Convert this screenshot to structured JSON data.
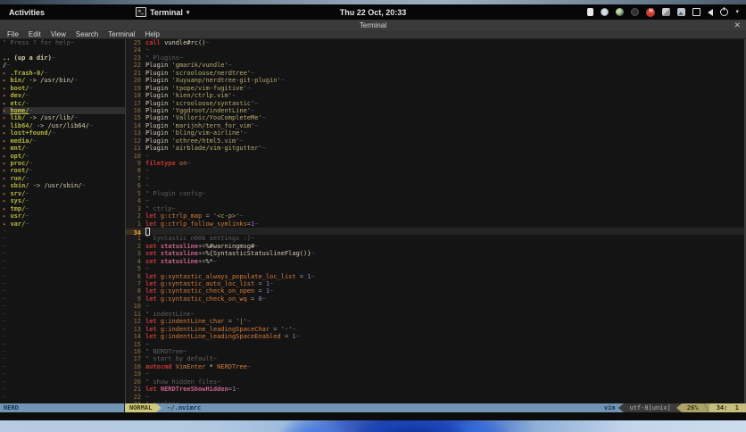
{
  "top_bar": {
    "activities": "Activities",
    "app_name": "Terminal",
    "app_caret": "▾",
    "clock": "Thu 22 Oct, 20:33",
    "terminal_icon_glyph": ">_",
    "tray": [
      {
        "name": "input-source-icon",
        "kind": "ti-input"
      },
      {
        "name": "timer-icon",
        "kind": "ti-timer"
      },
      {
        "name": "app-indicator-icon",
        "kind": "ti-cham"
      },
      {
        "name": "paw-app-icon",
        "kind": "ti-paw"
      },
      {
        "name": "recorder-h-icon",
        "kind": "ti-rec",
        "badge": "H"
      },
      {
        "name": "photos-icon",
        "kind": "ti-photos"
      },
      {
        "name": "screenshot-image-icon",
        "kind": "ti-image"
      },
      {
        "name": "display-icon",
        "kind": "ti-display"
      },
      {
        "name": "volume-icon",
        "kind": "ti-volume"
      },
      {
        "name": "power-icon",
        "kind": "ti-power"
      },
      {
        "name": "tray-caret-icon",
        "kind": "ti-caret",
        "badge": "▾"
      }
    ]
  },
  "window": {
    "title": "Terminal",
    "close": "✕",
    "menus": [
      "File",
      "Edit",
      "View",
      "Search",
      "Terminal",
      "Help"
    ]
  },
  "colors": {
    "blue": "#7295b5",
    "khaki": "#cec97e",
    "kw": "#c03732",
    "id": "#d27b38",
    "pk": "#c7608a",
    "str": "#b9aa6d",
    "num": "#9a79c6",
    "cmt": "#5f5f5f",
    "dir": "#b3b33f",
    "linenr": "#8a6d3b",
    "linenrcur": "#e8a33d",
    "eol": "#44566a"
  },
  "vim": {
    "nerdtree": [
      {
        "s": [
          [
            "cmt",
            "\" Press ? for help"
          ],
          [
            "eol",
            "~"
          ]
        ]
      },
      {
        "s": []
      },
      {
        "s": [
          [
            "upd",
            ".. (up a dir)"
          ],
          [
            "eol",
            "~"
          ]
        ]
      },
      {
        "s": [
          [
            "root",
            "/"
          ],
          [
            "eol",
            "~"
          ]
        ]
      },
      {
        "s": [
          [
            "bul",
            "▸ "
          ],
          [
            "dir",
            ".Trash-0/"
          ],
          [
            "eol",
            "~"
          ]
        ]
      },
      {
        "s": [
          [
            "bul",
            "▸ "
          ],
          [
            "dir",
            "bin/"
          ],
          [
            "lnk",
            " -> /usr/bin/"
          ],
          [
            "eol",
            "~"
          ]
        ]
      },
      {
        "s": [
          [
            "bul",
            "▸ "
          ],
          [
            "dir",
            "boot/"
          ],
          [
            "eol",
            "~"
          ]
        ]
      },
      {
        "s": [
          [
            "bul",
            "▸ "
          ],
          [
            "dir",
            "dev/"
          ],
          [
            "eol",
            "~"
          ]
        ]
      },
      {
        "s": [
          [
            "bul",
            "▸ "
          ],
          [
            "dir",
            "etc/"
          ],
          [
            "eol",
            "~"
          ]
        ]
      },
      {
        "hl": true,
        "s": [
          [
            "bul",
            "▸ "
          ],
          [
            "dirhl",
            "home/"
          ],
          [
            "eol",
            "~"
          ]
        ]
      },
      {
        "s": [
          [
            "bul",
            "▸ "
          ],
          [
            "dir",
            "lib/"
          ],
          [
            "lnk",
            " -> /usr/lib/"
          ],
          [
            "eol",
            "~"
          ]
        ]
      },
      {
        "s": [
          [
            "bul",
            "▸ "
          ],
          [
            "dir",
            "lib64/"
          ],
          [
            "lnk",
            " -> /usr/lib64/"
          ],
          [
            "eol",
            "~"
          ]
        ]
      },
      {
        "s": [
          [
            "bul",
            "▸ "
          ],
          [
            "dir",
            "lost+found/"
          ],
          [
            "eol",
            "~"
          ]
        ]
      },
      {
        "s": [
          [
            "bul",
            "▸ "
          ],
          [
            "dir",
            "media/"
          ],
          [
            "eol",
            "~"
          ]
        ]
      },
      {
        "s": [
          [
            "bul",
            "▸ "
          ],
          [
            "dir",
            "mnt/"
          ],
          [
            "eol",
            "~"
          ]
        ]
      },
      {
        "s": [
          [
            "bul",
            "▸ "
          ],
          [
            "dir",
            "opt/"
          ],
          [
            "eol",
            "~"
          ]
        ]
      },
      {
        "s": [
          [
            "bul",
            "▸ "
          ],
          [
            "dir",
            "proc/"
          ],
          [
            "eol",
            "~"
          ]
        ]
      },
      {
        "s": [
          [
            "bul",
            "▸ "
          ],
          [
            "dir",
            "root/"
          ],
          [
            "eol",
            "~"
          ]
        ]
      },
      {
        "s": [
          [
            "bul",
            "▸ "
          ],
          [
            "dir",
            "run/"
          ],
          [
            "eol",
            "~"
          ]
        ]
      },
      {
        "s": [
          [
            "bul",
            "▸ "
          ],
          [
            "dir",
            "sbin/"
          ],
          [
            "lnk",
            " -> /usr/sbin/"
          ],
          [
            "eol",
            "~"
          ]
        ]
      },
      {
        "s": [
          [
            "bul",
            "▸ "
          ],
          [
            "dir",
            "srv/"
          ],
          [
            "eol",
            "~"
          ]
        ]
      },
      {
        "s": [
          [
            "bul",
            "▸ "
          ],
          [
            "dir",
            "sys/"
          ],
          [
            "eol",
            "~"
          ]
        ]
      },
      {
        "s": [
          [
            "bul",
            "▸ "
          ],
          [
            "dir",
            "tmp/"
          ],
          [
            "eol",
            "~"
          ]
        ]
      },
      {
        "s": [
          [
            "bul",
            "▸ "
          ],
          [
            "dir",
            "usr/"
          ],
          [
            "eol",
            "~"
          ]
        ]
      },
      {
        "s": [
          [
            "bul",
            "▸ "
          ],
          [
            "dir",
            "var/"
          ],
          [
            "eol",
            "~"
          ]
        ]
      }
    ],
    "left_filler": 23,
    "above": [
      {
        "n": "25",
        "s": [
          [
            "kw",
            "call"
          ],
          [
            "txt",
            " vundle#rc()"
          ],
          [
            "eol",
            "~"
          ]
        ]
      },
      {
        "n": "24",
        "s": [
          [
            "eol",
            "~"
          ]
        ]
      },
      {
        "n": "23",
        "s": [
          [
            "cmt",
            "\" Plugins"
          ],
          [
            "eol",
            "~"
          ]
        ]
      },
      {
        "n": "22",
        "s": [
          [
            "txt",
            "Plugin "
          ],
          [
            "str",
            "'gmarik/vundle'"
          ],
          [
            "eol",
            "~"
          ]
        ]
      },
      {
        "n": "21",
        "s": [
          [
            "txt",
            "Plugin "
          ],
          [
            "str",
            "'scrooloose/nerdtree'"
          ],
          [
            "eol",
            "~"
          ]
        ]
      },
      {
        "n": "20",
        "s": [
          [
            "txt",
            "Plugin "
          ],
          [
            "str",
            "'Xuyuanp/nerdtree-git-plugin'"
          ],
          [
            "eol",
            "~"
          ]
        ]
      },
      {
        "n": "19",
        "s": [
          [
            "txt",
            "Plugin "
          ],
          [
            "str",
            "'tpope/vim-fugitive'"
          ],
          [
            "eol",
            "~"
          ]
        ]
      },
      {
        "n": "18",
        "s": [
          [
            "txt",
            "Plugin "
          ],
          [
            "str",
            "'kien/ctrlp.vim'"
          ],
          [
            "eol",
            "~"
          ]
        ]
      },
      {
        "n": "17",
        "s": [
          [
            "txt",
            "Plugin "
          ],
          [
            "str",
            "'scrooloose/syntastic'"
          ],
          [
            "eol",
            "~"
          ]
        ]
      },
      {
        "n": "16",
        "s": [
          [
            "txt",
            "Plugin "
          ],
          [
            "str",
            "'Yggdroot/indentLine'"
          ],
          [
            "eol",
            "~"
          ]
        ]
      },
      {
        "n": "15",
        "s": [
          [
            "txt",
            "Plugin "
          ],
          [
            "str",
            "'Valloric/YouCompleteMe'"
          ],
          [
            "eol",
            "~"
          ]
        ]
      },
      {
        "n": "14",
        "s": [
          [
            "txt",
            "Plugin "
          ],
          [
            "str",
            "'marijnh/tern_for_vim'"
          ],
          [
            "eol",
            "~"
          ]
        ]
      },
      {
        "n": "13",
        "s": [
          [
            "txt",
            "Plugin "
          ],
          [
            "str",
            "'bling/vim-airline'"
          ],
          [
            "eol",
            "~"
          ]
        ]
      },
      {
        "n": "12",
        "s": [
          [
            "txt",
            "Plugin "
          ],
          [
            "str",
            "'othree/html5.vim'"
          ],
          [
            "eol",
            "~"
          ]
        ]
      },
      {
        "n": "11",
        "s": [
          [
            "txt",
            "Plugin "
          ],
          [
            "str",
            "'airblade/vim-gitgutter'"
          ],
          [
            "eol",
            "~"
          ]
        ]
      },
      {
        "n": "10",
        "s": [
          [
            "eol",
            "~"
          ]
        ]
      },
      {
        "n": "9",
        "s": [
          [
            "kw",
            "filetype"
          ],
          [
            "id",
            " on"
          ],
          [
            "eol",
            "~"
          ]
        ]
      },
      {
        "n": "8",
        "s": [
          [
            "eol",
            "~"
          ]
        ]
      },
      {
        "n": "7",
        "s": [
          [
            "eol",
            "~"
          ]
        ]
      },
      {
        "n": "6",
        "s": [
          [
            "eol",
            "~"
          ]
        ]
      },
      {
        "n": "5",
        "s": [
          [
            "cmt",
            "\" Plugin config"
          ],
          [
            "eol",
            "~"
          ]
        ]
      },
      {
        "n": "4",
        "s": [
          [
            "eol",
            "~"
          ]
        ]
      },
      {
        "n": "3",
        "s": [
          [
            "cmt",
            "\" ctrlp"
          ],
          [
            "eol",
            "~"
          ]
        ]
      },
      {
        "n": "2",
        "s": [
          [
            "kw",
            "let"
          ],
          [
            "id",
            " g:ctrlp_map"
          ],
          [
            "op",
            " = "
          ],
          [
            "str",
            "'<c-p>'"
          ],
          [
            "eol",
            "~"
          ]
        ]
      },
      {
        "n": "1",
        "s": [
          [
            "kw",
            "let"
          ],
          [
            "id",
            " g:ctrlp_follow_symlinks"
          ],
          [
            "op",
            "="
          ],
          [
            "num",
            "1"
          ],
          [
            "eol",
            "~"
          ]
        ]
      }
    ],
    "cursor_line": {
      "n": "34",
      "cursor": true,
      "s": []
    },
    "below": [
      {
        "n": "1",
        "s": [
          [
            "cmt",
            "\" Syntastic n00b settings :)"
          ],
          [
            "eol",
            "~"
          ]
        ]
      },
      {
        "n": "2",
        "s": [
          [
            "kw",
            "set"
          ],
          [
            "pk",
            " statusline"
          ],
          [
            "op",
            "+="
          ],
          [
            "txt",
            "%#warningmsg#"
          ],
          [
            "eol",
            "~"
          ]
        ]
      },
      {
        "n": "3",
        "s": [
          [
            "kw",
            "set"
          ],
          [
            "pk",
            " statusline"
          ],
          [
            "op",
            "+="
          ],
          [
            "txt",
            "%{SyntasticStatuslineFlag()}"
          ],
          [
            "eol",
            "~"
          ]
        ]
      },
      {
        "n": "4",
        "s": [
          [
            "kw",
            "set"
          ],
          [
            "pk",
            " statusline"
          ],
          [
            "op",
            "+="
          ],
          [
            "txt",
            "%*"
          ],
          [
            "eol",
            "~"
          ]
        ]
      },
      {
        "n": "5",
        "s": [
          [
            "eol",
            "~"
          ]
        ]
      },
      {
        "n": "6",
        "s": [
          [
            "kw",
            "let"
          ],
          [
            "id",
            " g:syntastic_always_populate_loc_list"
          ],
          [
            "op",
            " = "
          ],
          [
            "num",
            "1"
          ],
          [
            "eol",
            "~"
          ]
        ]
      },
      {
        "n": "7",
        "s": [
          [
            "kw",
            "let"
          ],
          [
            "id",
            " g:syntastic_auto_loc_list"
          ],
          [
            "op",
            " = "
          ],
          [
            "num",
            "1"
          ],
          [
            "eol",
            "~"
          ]
        ]
      },
      {
        "n": "8",
        "s": [
          [
            "kw",
            "let"
          ],
          [
            "id",
            " g:syntastic_check_on_open"
          ],
          [
            "op",
            " = "
          ],
          [
            "num",
            "1"
          ],
          [
            "eol",
            "~"
          ]
        ]
      },
      {
        "n": "9",
        "s": [
          [
            "kw",
            "let"
          ],
          [
            "id",
            " g:syntastic_check_on_wq"
          ],
          [
            "op",
            " = "
          ],
          [
            "num",
            "0"
          ],
          [
            "eol",
            "~"
          ]
        ]
      },
      {
        "n": "10",
        "s": [
          [
            "eol",
            "~"
          ]
        ]
      },
      {
        "n": "11",
        "s": [
          [
            "cmt",
            "\" indentLine"
          ],
          [
            "eol",
            "~"
          ]
        ]
      },
      {
        "n": "12",
        "s": [
          [
            "kw",
            "let"
          ],
          [
            "id",
            " g:indentLine_char"
          ],
          [
            "op",
            " = "
          ],
          [
            "str",
            "'|'"
          ],
          [
            "eol",
            "~"
          ]
        ]
      },
      {
        "n": "13",
        "s": [
          [
            "kw",
            "let"
          ],
          [
            "id",
            " g:indentLine_leadingSpaceChar"
          ],
          [
            "op",
            " = "
          ],
          [
            "str",
            "'·'"
          ],
          [
            "eol",
            "~"
          ]
        ]
      },
      {
        "n": "14",
        "s": [
          [
            "kw",
            "let"
          ],
          [
            "id",
            " g:indentLine_leadingSpaceEnabled"
          ],
          [
            "op",
            " = "
          ],
          [
            "num",
            "1"
          ],
          [
            "eol",
            "~"
          ]
        ]
      },
      {
        "n": "15",
        "s": [
          [
            "eol",
            "~"
          ]
        ]
      },
      {
        "n": "16",
        "s": [
          [
            "cmt",
            "\" NERDTree"
          ],
          [
            "eol",
            "~"
          ]
        ]
      },
      {
        "n": "17",
        "s": [
          [
            "cmt",
            "\" start by default"
          ],
          [
            "eol",
            "~"
          ]
        ]
      },
      {
        "n": "18",
        "s": [
          [
            "kw",
            "autocmd"
          ],
          [
            "id",
            " VimEnter"
          ],
          [
            "txt",
            " * "
          ],
          [
            "id",
            "NERDTree"
          ],
          [
            "eol",
            "~"
          ]
        ]
      },
      {
        "n": "19",
        "s": [
          [
            "eol",
            "~"
          ]
        ]
      },
      {
        "n": "20",
        "s": [
          [
            "cmt",
            "\" show hidden files"
          ],
          [
            "eol",
            "~"
          ]
        ]
      },
      {
        "n": "21",
        "s": [
          [
            "kw",
            "let"
          ],
          [
            "pk",
            " NERDTreeShowHidden"
          ],
          [
            "op",
            "="
          ],
          [
            "num",
            "1"
          ],
          [
            "eol",
            "~"
          ]
        ]
      },
      {
        "n": "22",
        "s": [
          [
            "eol",
            "~"
          ]
        ]
      },
      {
        "n": "23",
        "s": [
          [
            "cmt",
            "\" airline"
          ],
          [
            "eol",
            "~"
          ]
        ]
      }
    ]
  },
  "statusline": {
    "nerd": "NERD",
    "mode": "NORMAL",
    "filename": "~/.nvimrc",
    "filetype": "vim",
    "encoding": "utf-8[unix]",
    "percent": "26%",
    "thin_sep": "╲",
    "position": "34:  1"
  }
}
